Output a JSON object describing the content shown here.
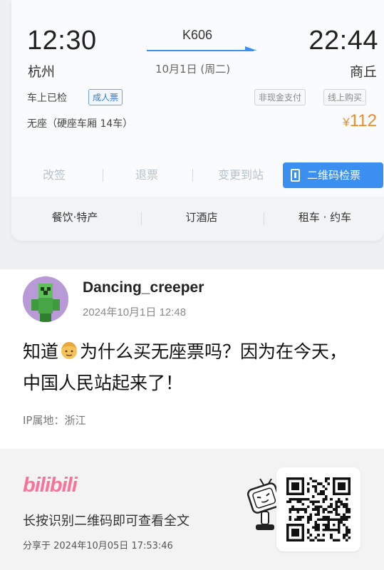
{
  "ticket": {
    "departure_time": "12:30",
    "arrival_time": "22:44",
    "departure_city": "杭州",
    "arrival_city": "商丘",
    "train_number": "K606",
    "date": "10月1日 (周二)",
    "status": "车上已检",
    "passenger_type": "成人票",
    "payment_tag": "非现金支付",
    "purchase_tag": "线上购买",
    "seat": "无座（硬座车厢 14车）",
    "price_symbol": "¥",
    "price": "112",
    "actions": {
      "change": "改签",
      "refund": "退票",
      "change_station": "变更到站",
      "qr_check": "二维码检票"
    },
    "services": {
      "food": "餐饮·特产",
      "hotel": "订酒店",
      "car": "租车 · 约车"
    },
    "colors": {
      "accent_blue": "#3a8ff0",
      "price_orange": "#f08a27"
    }
  },
  "post": {
    "username": "Dancing_creeper",
    "timestamp": "2024年10月1日 12:48",
    "text_part1": "知道",
    "emoji": "man-face-emoji",
    "text_part2": "为什么买无座票吗？因为在今天，中国人民站起来了！",
    "ip_location": "IP属地：浙江"
  },
  "footer": {
    "brand": "bilibili",
    "prompt": "长按识别二维码即可查看全文",
    "share_time": "分享于 2024年10月05日 17:53:46",
    "brand_color": "#fb7299"
  }
}
